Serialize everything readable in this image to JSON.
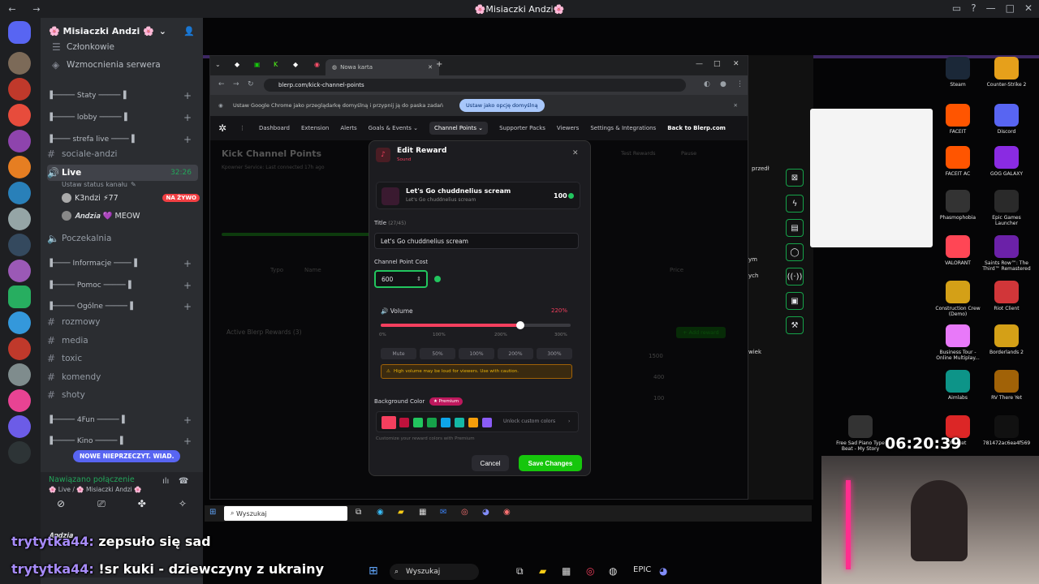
{
  "titlebar": {
    "title": "🌸Misiaczki Andzi🌸"
  },
  "server": {
    "name": "🌸 Misiaczki Andzi 🌸",
    "top_items": [
      "Członkowie",
      "Wzmocnienia serwera"
    ],
    "channels": [
      {
        "label": "▐───── Staty ─────▐",
        "type": "cat"
      },
      {
        "label": "▐───── lobby ─────▐",
        "type": "cat"
      },
      {
        "label": "▐──── strefa live ────▐",
        "type": "cat"
      },
      {
        "label": "sociale-andzi",
        "type": "text"
      },
      {
        "label": "Live",
        "type": "voice"
      },
      {
        "label": "Poczekalnia",
        "type": "voice"
      },
      {
        "label": "▐──── Informacje ────▐",
        "type": "cat"
      },
      {
        "label": "▐───── Pomoc ─────▐",
        "type": "cat"
      },
      {
        "label": "▐───── Ogólne ─────▐",
        "type": "cat"
      },
      {
        "label": "rozmowy",
        "type": "text"
      },
      {
        "label": "media",
        "type": "text"
      },
      {
        "label": "toxic",
        "type": "text"
      },
      {
        "label": "komendy",
        "type": "text"
      },
      {
        "label": "shoty",
        "type": "text"
      },
      {
        "label": "▐───── 4Fun ─────▐",
        "type": "cat"
      },
      {
        "label": "▐───── Kino ─────▐",
        "type": "cat"
      }
    ],
    "live_time": "32:26",
    "status_hint": "Ustaw status kanału",
    "members": [
      {
        "name": "K3ndzi ⚡77",
        "badge": "NA ŻYWO"
      },
      {
        "name": "𝑨𝒏𝒅𝒛𝒊𝒂 💜 MEOW",
        "badge": ""
      }
    ],
    "new_messages": "NOWE NIEPRZECZYT. WIAD."
  },
  "voice": {
    "status": "Nawiązano połączenie",
    "location": "🌸 Live / 🌸 Misiaczki Andzi 🌸",
    "user": "𝑨𝒏𝒅𝒛𝒊𝒂"
  },
  "chrome": {
    "tab_title": "Nowa karta",
    "url": "blerp.com/kick-channel-points",
    "info_text": "Ustaw Google Chrome jako przeglądarkę domyślną i przypnij ją do paska zadań",
    "info_button": "Ustaw jako opcję domyślną"
  },
  "blerp_nav": [
    "Dashboard",
    "Extension",
    "Alerts",
    "Goals & Events ⌄",
    "Channel Points ⌄",
    "Supporter Packs",
    "Viewers",
    "Settings & Integrations",
    "Back to Blerp.com"
  ],
  "background_page": {
    "title": "Kick Channel Points",
    "status": "Kpowner Service: Last connected 17h ago",
    "test_rewards": "Test Rewards",
    "pause": "Pause",
    "active_rewards": "Active Blerp Rewards (3)",
    "col_type": "Typo",
    "col_name": "Name",
    "col_price": "Price",
    "add_reward": "+ Add reward",
    "prices": [
      "1500",
      "400",
      "100"
    ]
  },
  "modal": {
    "title": "Edit Reward",
    "subtitle": "Sound",
    "reward_name": "Let's Go chuddnelius scream",
    "reward_sub": "Let's Go chuddnelius scream",
    "reward_cost": "100",
    "title_label": "Title",
    "title_count": "(27/45)",
    "title_value": "Let's Go chuddnelius scream",
    "cost_label": "Channel Point Cost",
    "cost_value": "600",
    "volume_label": "Volume",
    "volume_value": "220%",
    "volume_level_pct": 220,
    "volume_ticks": [
      "0%",
      "100%",
      "200%",
      "300%"
    ],
    "volume_buttons": [
      "Mute",
      "50%",
      "100%",
      "200%",
      "300%"
    ],
    "warning": "High volume may be loud for viewers. Use with caution.",
    "bg_label": "Background Color",
    "premium": "★ Premium",
    "unlock": "Unlock custom colors",
    "customize_hint": "Customize your reward colors with Premium",
    "cancel": "Cancel",
    "save": "Save Changes",
    "swatches": [
      "#f43f5e",
      "#be123c",
      "#22c55e",
      "#16a34a",
      "#0ea5e9",
      "#14b8a6",
      "#f59e0b",
      "#8b5cf6"
    ]
  },
  "side_tools": {
    "labels": [
      "przedł",
      "ym",
      "ych",
      "wiek"
    ]
  },
  "desktop_icons": [
    {
      "label": "Steam",
      "color": "#1b2838"
    },
    {
      "label": "Counter-Strike 2",
      "color": "#e6a01b"
    },
    {
      "label": "FACEIT",
      "color": "#ff5500"
    },
    {
      "label": "Discord",
      "color": "#5865f2"
    },
    {
      "label": "FACEIT AC",
      "color": "#ff5500"
    },
    {
      "label": "GOG GALAXY",
      "color": "#8a2be2"
    },
    {
      "label": "Phasmophobia",
      "color": "#333333"
    },
    {
      "label": "Epic Games Launcher",
      "color": "#2a2a2a"
    },
    {
      "label": "VALORANT",
      "color": "#ff4655"
    },
    {
      "label": "Saints Row™: The Third™ Remastered",
      "color": "#6b21a8"
    },
    {
      "label": "Construction Crew (Demo)",
      "color": "#d4a017"
    },
    {
      "label": "Riot Client",
      "color": "#d13639"
    },
    {
      "label": "Business Tour - Online Multiplay...",
      "color": "#e879f9"
    },
    {
      "label": "Borderlands 2",
      "color": "#d4a017"
    },
    {
      "label": "Aimlabs",
      "color": "#0d9488"
    },
    {
      "label": "RV There Yet",
      "color": "#a16207"
    },
    {
      "label": "Free Sad Piano Type Beat - My Story",
      "color": "#333333"
    },
    {
      "label": "Market",
      "color": "#dc2626"
    },
    {
      "label": "781472ac6ea4f569",
      "color": "#111111"
    }
  ],
  "clock": "06:20:39",
  "inner_taskbar": {
    "search": "Wyszukaj"
  },
  "chat": [
    {
      "user": "trytytka44:",
      "text": " zepsuło się sad"
    },
    {
      "user": "trytytka44:",
      "text": " !sr kuki - dziewczyny z ukrainy"
    }
  ],
  "win_taskbar": {
    "search": "Wyszukaj"
  }
}
